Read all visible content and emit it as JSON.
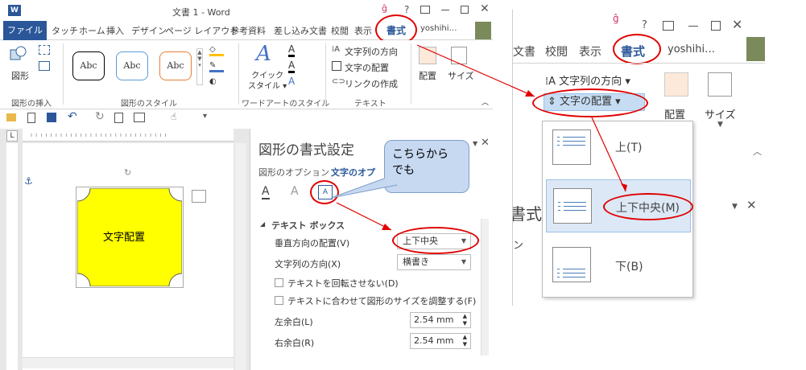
{
  "window": {
    "title": "文書 1 - Word",
    "help": "?",
    "tabs": [
      "ファイル",
      "タッチ",
      "ホーム",
      "挿入",
      "デザイン",
      "ページ レイアウト",
      "参考資料",
      "差し込み文書",
      "校閲",
      "表示",
      "書式"
    ],
    "user": "yoshihi…"
  },
  "ribbon": {
    "shape_btn": "図形",
    "style_samples": [
      "Abc",
      "Abc",
      "Abc"
    ],
    "quick_style": "クイック\nスタイル",
    "text_direction": "文字列の方向",
    "text_align": "文字の配置",
    "link": "リンクの作成",
    "arrange": "配置",
    "size": "サイズ",
    "groups": [
      "図形の挿入",
      "図形のスタイル",
      "ワードアートのスタイル",
      "テキスト"
    ]
  },
  "doc": {
    "shape_text": "文字配置",
    "colors": {
      "shape_fill": "#ffff00",
      "accent": "#2b579a",
      "red": "#e00000"
    }
  },
  "pane": {
    "title": "図形の書式設定",
    "tab1": "図形のオプション",
    "tab2": "文字のオプ",
    "section": "テキスト ボックス",
    "rows": {
      "vertical": "垂直方向の配置(V)",
      "vertical_value": "上下中央",
      "direction": "文字列の方向(X)",
      "direction_value": "横書き",
      "no_rotate": "テキストを回転させない(D)",
      "autofit": "テキストに合わせて図形のサイズを調整する(F)",
      "left_margin": "左余白(L)",
      "left_value": "2.54 mm",
      "right_margin": "右余白(R)",
      "right_value": "2.54 mm"
    },
    "callout": "こちらから\nでも"
  },
  "zoom": {
    "tabs": [
      "文書",
      "校閲",
      "表示",
      "書式"
    ],
    "user": "yoshihi…",
    "help": "?",
    "text_direction": "文字列の方向",
    "text_align": "文字の配置",
    "arrange": "配置",
    "size": "サイズ",
    "pane_partial1": "書式",
    "pane_partial2": "ン",
    "options": [
      "上(T)",
      "上下中央(M)",
      "下(B)"
    ]
  }
}
